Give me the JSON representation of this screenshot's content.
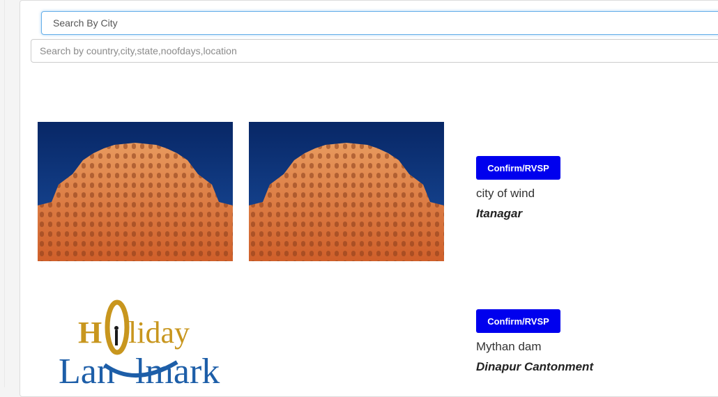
{
  "search": {
    "city_placeholder": "Search By City",
    "multi_placeholder": "Search by country,city,state,noofdays,location"
  },
  "listings": [
    {
      "button_label": "Confirm/RVSP",
      "description": "city of wind",
      "city": "Itanagar",
      "images": [
        "hawa-mahal-photo",
        "hawa-mahal-photo"
      ]
    },
    {
      "button_label": "Confirm/RVSP",
      "description": "Mythan dam",
      "city": "Dinapur Cantonment",
      "images": [
        "holiday-landmark-logo"
      ]
    }
  ],
  "logo": {
    "line1": "HOliday",
    "line2": "Landmark"
  },
  "colors": {
    "button_bg": "#0000ee",
    "sky": "#0b2f7a",
    "palace": "#e07a3f",
    "logo_gold": "#c8961e",
    "logo_blue": "#1d5ea8"
  }
}
